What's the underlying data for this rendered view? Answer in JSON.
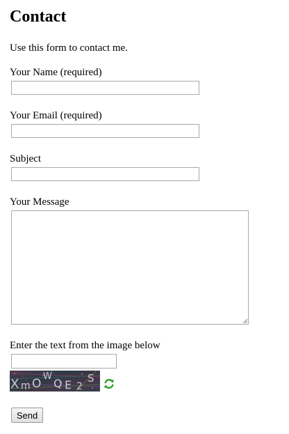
{
  "page": {
    "title": "Contact",
    "intro": "Use this form to contact me."
  },
  "form": {
    "name_label": "Your Name (required)",
    "name_value": "",
    "email_label": "Your Email (required)",
    "email_value": "",
    "subject_label": "Subject",
    "subject_value": "",
    "message_label": "Your Message",
    "message_value": "",
    "captcha_label": "Enter the text from the image below",
    "captcha_value": "",
    "captcha_text": "XmOWQE2S",
    "send_label": "Send"
  },
  "icons": {
    "captcha_refresh": "refresh-icon"
  },
  "colors": {
    "refresh_icon": "#2e9e2e",
    "captcha_background": "#3a3a48",
    "input_border": "#a9a9a9"
  }
}
